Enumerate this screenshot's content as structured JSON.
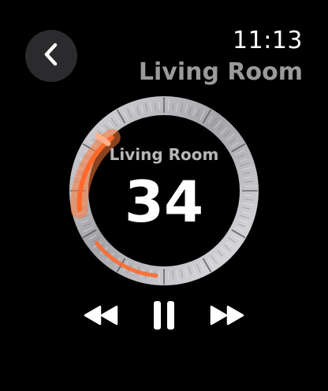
{
  "status": {
    "time": "11:13"
  },
  "header": {
    "room_title": "Living Room"
  },
  "volume": {
    "label": "Living Room",
    "value": "34",
    "accent_color": "#ff6a2b"
  },
  "icons": {
    "back": "chevron-left-icon",
    "rewind": "rewind-icon",
    "pause": "pause-icon",
    "forward": "fast-forward-icon"
  }
}
